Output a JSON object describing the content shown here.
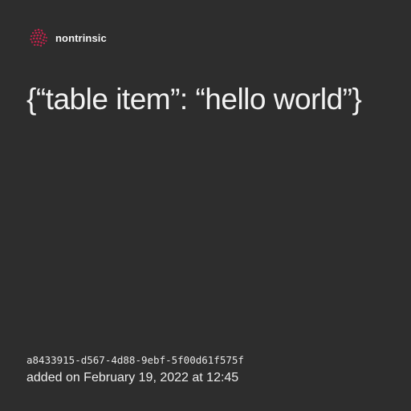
{
  "brand": {
    "name": "nontrinsic",
    "logo_icon": "brain-dots-logo",
    "logo_color": "#c2224b"
  },
  "card": {
    "background": "#2d2d2d",
    "text_color": "#f2f2f2",
    "headline": "{“table item”: “hello world”}",
    "id": "a8433915-d567-4d88-9ebf-5f00d61f575f",
    "added": "added on February 19, 2022 at 12:45"
  }
}
